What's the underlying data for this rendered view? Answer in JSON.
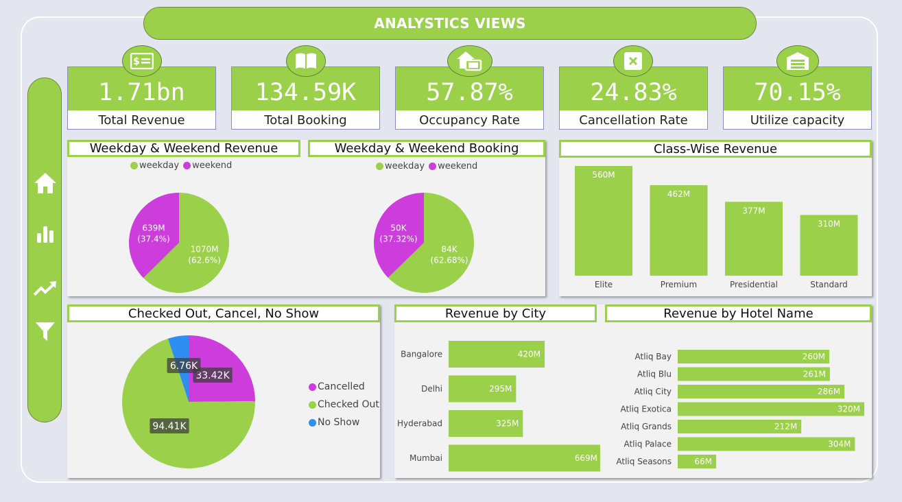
{
  "header": {
    "title": "ANALYSTICS VIEWS"
  },
  "sidebar": {
    "items": [
      {
        "icon": "home-icon"
      },
      {
        "icon": "bar-chart-icon"
      },
      {
        "icon": "trend-up-icon"
      },
      {
        "icon": "filter-icon"
      }
    ]
  },
  "kpis": [
    {
      "value": "1.71bn",
      "label": "Total Revenue",
      "icon": "money-icon"
    },
    {
      "value": "134.59K",
      "label": "Total Booking",
      "icon": "book-icon"
    },
    {
      "value": "57.87%",
      "label": "Occupancy Rate",
      "icon": "house-occupancy-icon"
    },
    {
      "value": "24.83%",
      "label": "Cancellation Rate",
      "icon": "cancel-icon"
    },
    {
      "value": "70.15%",
      "label": "Utilize capacity",
      "icon": "garage-icon"
    }
  ],
  "colors": {
    "green": "#9bd04b",
    "magenta": "#cc3ddb",
    "blue": "#2f8ef0"
  },
  "chart_data": [
    {
      "type": "pie",
      "title": "Weekday & Weekend Revenue",
      "legend": [
        "weekday",
        "weekend"
      ],
      "slices": [
        {
          "name": "weekday",
          "value": 1070,
          "value_label": "1070M",
          "pct_label": "(62.6%)"
        },
        {
          "name": "weekend",
          "value": 639,
          "value_label": "639M",
          "pct_label": "(37.4%)"
        }
      ]
    },
    {
      "type": "pie",
      "title": "Weekday & Weekend Booking",
      "legend": [
        "weekday",
        "weekend"
      ],
      "slices": [
        {
          "name": "weekday",
          "value": 84,
          "value_label": "84K",
          "pct_label": "(62.68%)"
        },
        {
          "name": "weekend",
          "value": 50,
          "value_label": "50K",
          "pct_label": "(37.32%)"
        }
      ]
    },
    {
      "type": "bar",
      "title": "Class-Wise Revenue",
      "categories": [
        "Elite",
        "Premium",
        "Presidential",
        "Standard"
      ],
      "values": [
        560,
        462,
        377,
        310
      ],
      "value_labels": [
        "560M",
        "462M",
        "377M",
        "310M"
      ]
    },
    {
      "type": "pie",
      "title": "Checked Out, Cancel, No Show",
      "legend": [
        "Cancelled",
        "Checked Out",
        "No Show"
      ],
      "slices": [
        {
          "name": "Cancelled",
          "value": 33.42,
          "value_label": "33.42K"
        },
        {
          "name": "Checked Out",
          "value": 94.41,
          "value_label": "94.41K"
        },
        {
          "name": "No Show",
          "value": 6.76,
          "value_label": "6.76K"
        }
      ]
    },
    {
      "type": "bar",
      "orientation": "horizontal",
      "title": "Revenue  by City",
      "categories": [
        "Bangalore",
        "Delhi",
        "Hyderabad",
        "Mumbai"
      ],
      "values": [
        420,
        295,
        325,
        669
      ],
      "value_labels": [
        "420M",
        "295M",
        "325M",
        "669M"
      ]
    },
    {
      "type": "bar",
      "orientation": "horizontal",
      "title": "Revenue  by Hotel Name",
      "categories": [
        "Atliq Bay",
        "Atliq Blu",
        "Atliq City",
        "Atliq Exotica",
        "Atliq Grands",
        "Atliq Palace",
        "Atliq Seasons"
      ],
      "values": [
        260,
        261,
        286,
        320,
        212,
        304,
        66
      ],
      "value_labels": [
        "260M",
        "261M",
        "286M",
        "320M",
        "212M",
        "304M",
        "66M"
      ]
    }
  ]
}
